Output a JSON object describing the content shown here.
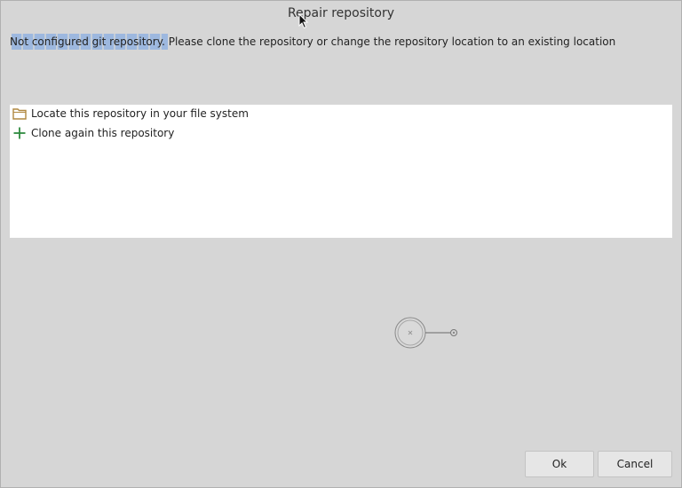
{
  "dialog": {
    "title": "Repair repository",
    "message": "Not configured git repository. Please clone the repository or change the repository location to an existing location"
  },
  "options": [
    {
      "label": "Locate this repository in your file system",
      "icon": "folder-icon"
    },
    {
      "label": "Clone again this repository",
      "icon": "plus-icon"
    }
  ],
  "buttons": {
    "ok_label": "Ok",
    "cancel_label": "Cancel"
  },
  "colors": {
    "folder": "#b08840",
    "plus": "#2e8b3e",
    "background": "#d6d6d6"
  }
}
